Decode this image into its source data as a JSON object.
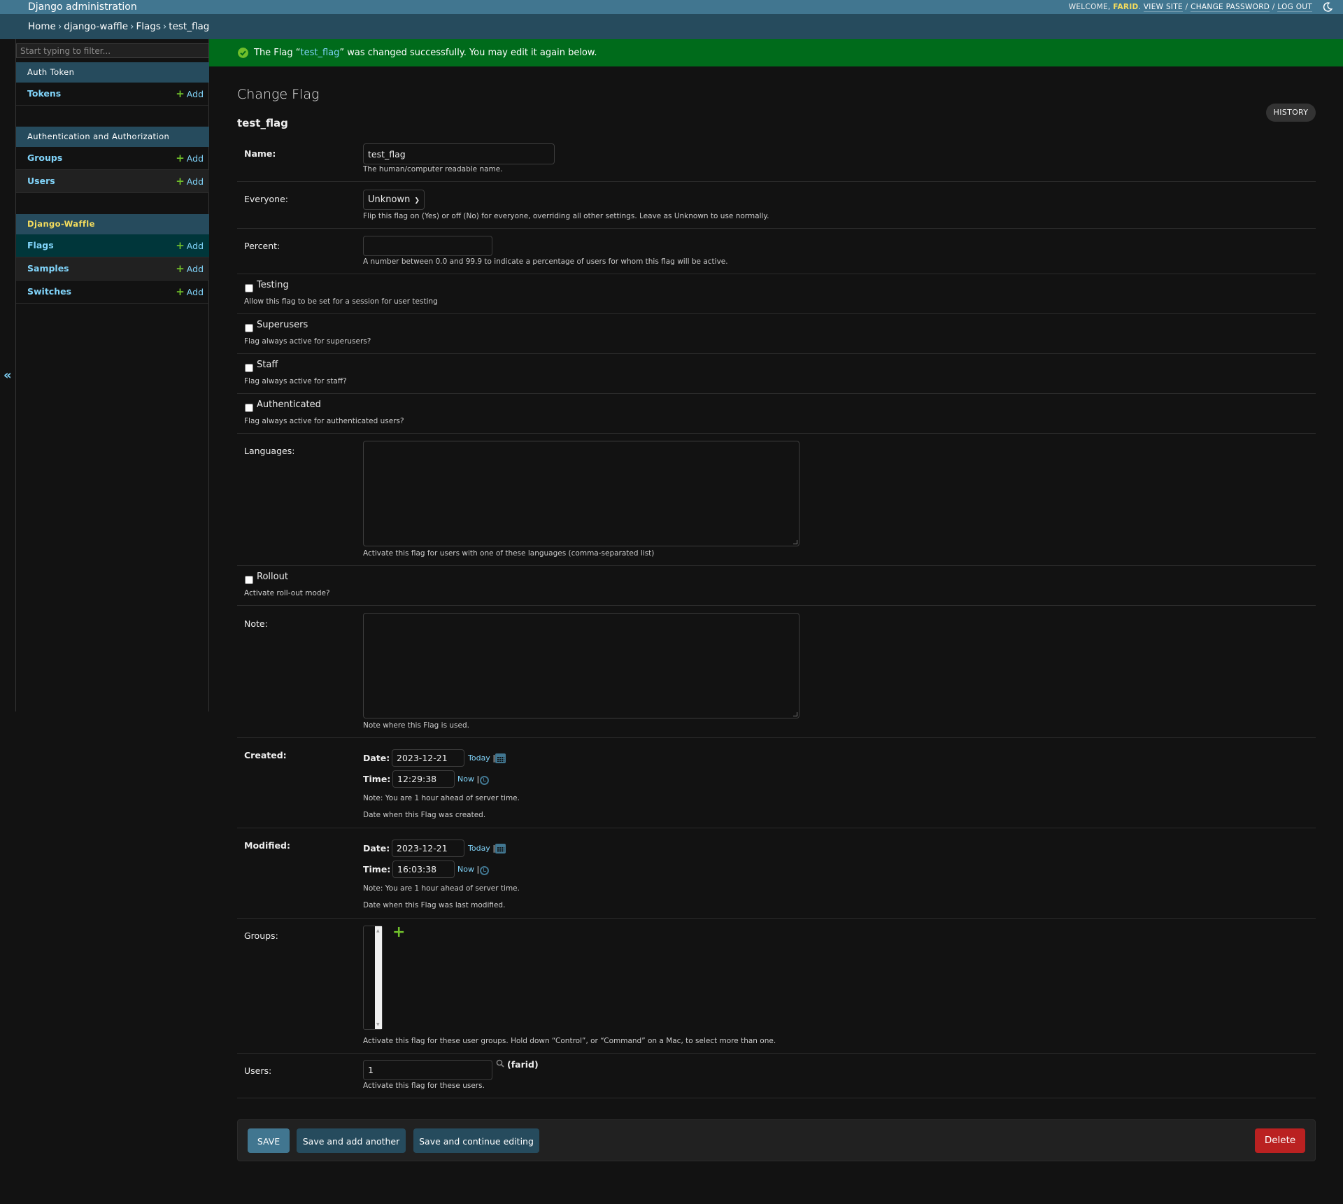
{
  "header": {
    "branding": "Django administration",
    "welcome": "Welcome,",
    "username": "FARID",
    "view_site": "View site",
    "change_password": "Change password",
    "log_out": "Log out",
    "theme_icon": "moon-icon"
  },
  "breadcrumbs": [
    {
      "label": "Home"
    },
    {
      "label": "django-waffle"
    },
    {
      "label": "Flags"
    },
    {
      "label": "test_flag"
    }
  ],
  "breadcrumb_separator": "›",
  "sidebar": {
    "filter_placeholder": "Start typing to filter...",
    "add_label": "Add",
    "collapse_icon": "«",
    "modules": [
      {
        "caption": "Auth Token",
        "models": [
          {
            "name": "Tokens"
          }
        ]
      },
      {
        "caption": "Authentication and Authorization",
        "models": [
          {
            "name": "Groups"
          },
          {
            "name": "Users"
          }
        ]
      },
      {
        "caption": "Django-Waffle",
        "current": true,
        "models": [
          {
            "name": "Flags",
            "current": true
          },
          {
            "name": "Samples"
          },
          {
            "name": "Switches"
          }
        ]
      }
    ]
  },
  "message": {
    "prefix": "The Flag “",
    "link": "test_flag",
    "suffix": "” was changed successfully. You may edit it again below.",
    "type": "success"
  },
  "page": {
    "title": "Change Flag",
    "object": "test_flag",
    "history_label": "History"
  },
  "form": {
    "name": {
      "label": "Name:",
      "value": "test_flag",
      "help": "The human/computer readable name."
    },
    "everyone": {
      "label": "Everyone:",
      "value": "Unknown",
      "help": "Flip this flag on (Yes) or off (No) for everyone, overriding all other settings. Leave as Unknown to use normally."
    },
    "percent": {
      "label": "Percent:",
      "value": "",
      "help": "A number between 0.0 and 99.9 to indicate a percentage of users for whom this flag will be active."
    },
    "testing": {
      "label": "Testing",
      "checked": false,
      "help": "Allow this flag to be set for a session for user testing"
    },
    "superusers": {
      "label": "Superusers",
      "checked": false,
      "help": "Flag always active for superusers?"
    },
    "staff": {
      "label": "Staff",
      "checked": false,
      "help": "Flag always active for staff?"
    },
    "authenticated": {
      "label": "Authenticated",
      "checked": false,
      "help": "Flag always active for authenticated users?"
    },
    "languages": {
      "label": "Languages:",
      "value": "",
      "help": "Activate this flag for users with one of these languages (comma-separated list)"
    },
    "rollout": {
      "label": "Rollout",
      "checked": false,
      "help": "Activate roll-out mode?"
    },
    "note": {
      "label": "Note:",
      "value": "",
      "help": "Note where this Flag is used."
    },
    "created": {
      "label": "Created:",
      "date_label": "Date:",
      "date": "2023-12-21",
      "today": "Today",
      "time_label": "Time:",
      "time": "12:29:38",
      "now": "Now",
      "tz_note": "Note: You are 1 hour ahead of server time.",
      "help": "Date when this Flag was created."
    },
    "modified": {
      "label": "Modified:",
      "date_label": "Date:",
      "date": "2023-12-21",
      "today": "Today",
      "time_label": "Time:",
      "time": "16:03:38",
      "now": "Now",
      "tz_note": "Note: You are 1 hour ahead of server time.",
      "help": "Date when this Flag was last modified."
    },
    "groups": {
      "label": "Groups:",
      "options": [],
      "help": "Activate this flag for these user groups. Hold down “Control”, or “Command” on a Mac, to select more than one."
    },
    "users": {
      "label": "Users:",
      "value": "1",
      "lookup_name": "(farid)",
      "help": "Activate this flag for these users."
    }
  },
  "submit": {
    "save": "SAVE",
    "save_add": "Save and add another",
    "save_continue": "Save and continue editing",
    "delete": "Delete"
  },
  "colors": {
    "header": "#417690",
    "breadcrumbs": "#264b5d",
    "success": "#006b1b",
    "link": "#81d4fa",
    "add_green": "#70bf2b",
    "delete": "#ba2121",
    "background": "#121212"
  }
}
